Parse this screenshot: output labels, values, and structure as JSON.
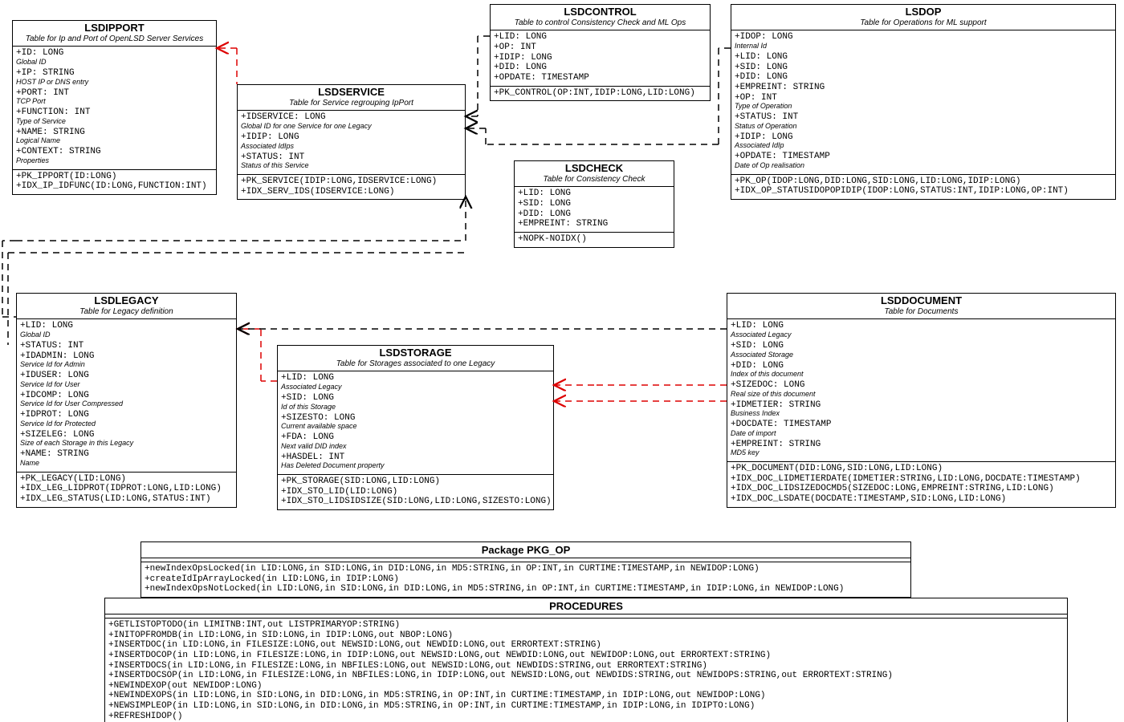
{
  "tables": {
    "lsdipport": {
      "name": "LSDIPPORT",
      "desc": "Table for Ip and Port of OpenLSD Server Services",
      "attrs": [
        {
          "sig": "+ID: LONG",
          "desc": "Global ID"
        },
        {
          "sig": "+IP: STRING",
          "desc": "HOST IP or DNS entry"
        },
        {
          "sig": "+PORT: INT",
          "desc": "TCP Port"
        },
        {
          "sig": "+FUNCTION: INT",
          "desc": "Type of Service"
        },
        {
          "sig": "+NAME: STRING",
          "desc": "Logical Name"
        },
        {
          "sig": "+CONTEXT: STRING",
          "desc": "Properties"
        }
      ],
      "ops": [
        "+PK_IPPORT(ID:LONG)",
        "+IDX_IP_IDFUNC(ID:LONG,FUNCTION:INT)"
      ]
    },
    "lsdservice": {
      "name": "LSDSERVICE",
      "desc": "Table for Service regrouping IpPort",
      "attrs": [
        {
          "sig": "+IDSERVICE: LONG",
          "desc": "Global ID for one Service for one Legacy"
        },
        {
          "sig": "+IDIP: LONG",
          "desc": "Associated IdIps"
        },
        {
          "sig": "+STATUS: INT",
          "desc": "Status of this Service"
        }
      ],
      "ops": [
        "+PK_SERVICE(IDIP:LONG,IDSERVICE:LONG)",
        "+IDX_SERV_IDS(IDSERVICE:LONG)"
      ]
    },
    "lsdcontrol": {
      "name": "LSDCONTROL",
      "desc": "Table to control Consistency Check and ML Ops",
      "attrs": [
        {
          "sig": "+LID: LONG"
        },
        {
          "sig": "+OP: INT"
        },
        {
          "sig": "+IDIP: LONG"
        },
        {
          "sig": "+DID: LONG"
        },
        {
          "sig": "+OPDATE: TIMESTAMP"
        }
      ],
      "ops": [
        "+PK_CONTROL(OP:INT,IDIP:LONG,LID:LONG)"
      ]
    },
    "lsdop": {
      "name": "LSDOP",
      "desc": "Table for Operations for ML support",
      "attrs": [
        {
          "sig": "+IDOP: LONG",
          "desc": "Internal Id"
        },
        {
          "sig": "+LID: LONG"
        },
        {
          "sig": "+SID: LONG"
        },
        {
          "sig": "+DID: LONG"
        },
        {
          "sig": "+EMPREINT: STRING"
        },
        {
          "sig": "+OP: INT",
          "desc": "Type of Operation"
        },
        {
          "sig": "+STATUS: INT",
          "desc": "Status of Operation"
        },
        {
          "sig": "+IDIP: LONG",
          "desc": "Associated IdIp"
        },
        {
          "sig": "+OPDATE: TIMESTAMP",
          "desc": "Date of Op realisation"
        }
      ],
      "ops": [
        "+PK_OP(IDOP:LONG,DID:LONG,SID:LONG,LID:LONG,IDIP:LONG)",
        "+IDX_OP_STATUSIDOPOPIDIP(IDOP:LONG,STATUS:INT,IDIP:LONG,OP:INT)"
      ]
    },
    "lsdcheck": {
      "name": "LSDCHECK",
      "desc": "Table for Consistency Check",
      "attrs": [
        {
          "sig": "+LID: LONG"
        },
        {
          "sig": "+SID: LONG"
        },
        {
          "sig": "+DID: LONG"
        },
        {
          "sig": "+EMPREINT: STRING"
        }
      ],
      "ops": [
        "+NOPK-NOIDX()"
      ]
    },
    "lsdlegacy": {
      "name": "LSDLEGACY",
      "desc": "Table for Legacy definition",
      "attrs": [
        {
          "sig": "+LID: LONG",
          "desc": "Global ID"
        },
        {
          "sig": "+STATUS: INT"
        },
        {
          "sig": "+IDADMIN: LONG",
          "desc": "Service Id for Admin"
        },
        {
          "sig": "+IDUSER: LONG",
          "desc": "Service Id for User"
        },
        {
          "sig": "+IDCOMP: LONG",
          "desc": "Service Id for User Compressed"
        },
        {
          "sig": "+IDPROT: LONG",
          "desc": "Service Id for Protected"
        },
        {
          "sig": "+SIZELEG: LONG",
          "desc": "Size of each Storage in this Legacy"
        },
        {
          "sig": "+NAME: STRING",
          "desc": "Name"
        }
      ],
      "ops": [
        "+PK_LEGACY(LID:LONG)",
        "+IDX_LEG_LIDPROT(IDPROT:LONG,LID:LONG)",
        "+IDX_LEG_STATUS(LID:LONG,STATUS:INT)"
      ]
    },
    "lsdstorage": {
      "name": "LSDSTORAGE",
      "desc": "Table for Storages associated to one Legacy",
      "attrs": [
        {
          "sig": "+LID: LONG",
          "desc": "Associated Legacy"
        },
        {
          "sig": "+SID: LONG",
          "desc": "Id of this Storage"
        },
        {
          "sig": "+SIZESTO: LONG",
          "desc": "Current available space"
        },
        {
          "sig": "+FDA: LONG",
          "desc": "Next valid DID index"
        },
        {
          "sig": "+HASDEL: INT",
          "desc": "Has Deleted Document property"
        }
      ],
      "ops": [
        "+PK_STORAGE(SID:LONG,LID:LONG)",
        "+IDX_STO_LID(LID:LONG)",
        "+IDX_STO_LIDSIDSIZE(SID:LONG,LID:LONG,SIZESTO:LONG)"
      ]
    },
    "lsddocument": {
      "name": "LSDDOCUMENT",
      "desc": "Table for Documents",
      "attrs": [
        {
          "sig": "+LID: LONG",
          "desc": "Associated Legacy"
        },
        {
          "sig": "+SID: LONG",
          "desc": "Associated Storage"
        },
        {
          "sig": "+DID: LONG",
          "desc": "Index of this document"
        },
        {
          "sig": "+SIZEDOC: LONG",
          "desc": "Real size of this document"
        },
        {
          "sig": "+IDMETIER: STRING",
          "desc": "Business Index"
        },
        {
          "sig": "+DOCDATE: TIMESTAMP",
          "desc": "Date of import"
        },
        {
          "sig": "+EMPREINT: STRING",
          "desc": "MD5 key"
        }
      ],
      "ops": [
        "+PK_DOCUMENT(DID:LONG,SID:LONG,LID:LONG)",
        "+IDX_DOC_LIDMETIERDATE(IDMETIER:STRING,LID:LONG,DOCDATE:TIMESTAMP)",
        "+IDX_DOC_LIDSIZEDOCMD5(SIZEDOC:LONG,EMPREINT:STRING,LID:LONG)",
        "+IDX_DOC_LSDATE(DOCDATE:TIMESTAMP,SID:LONG,LID:LONG)"
      ]
    }
  },
  "packages": {
    "pkg_op": {
      "name": "Package PKG_OP",
      "lines": [
        "+newIndexOpsLocked(in LID:LONG,in SID:LONG,in DID:LONG,in MD5:STRING,in OP:INT,in CURTIME:TIMESTAMP,in NEWIDOP:LONG)",
        "+createIdIpArrayLocked(in LID:LONG,in IDIP:LONG)",
        "+newIndexOpsNotLocked(in LID:LONG,in SID:LONG,in DID:LONG,in MD5:STRING,in OP:INT,in CURTIME:TIMESTAMP,in IDIP:LONG,in NEWIDOP:LONG)"
      ]
    },
    "procedures": {
      "name": "PROCEDURES",
      "lines": [
        "+GETLISTOPTODO(in LIMITNB:INT,out LISTPRIMARYOP:STRING)",
        "+INITOPFROMDB(in LID:LONG,in SID:LONG,in IDIP:LONG,out NBOP:LONG)",
        "+INSERTDOC(in LID:LONG,in FILESIZE:LONG,out NEWSID:LONG,out NEWDID:LONG,out ERRORTEXT:STRING)",
        "+INSERTDOCOP(in LID:LONG,in FILESIZE:LONG,in IDIP:LONG,out NEWSID:LONG,out NEWDID:LONG,out NEWIDOP:LONG,out ERRORTEXT:STRING)",
        "+INSERTDOCS(in LID:LONG,in FILESIZE:LONG,in NBFILES:LONG,out NEWSID:LONG,out NEWDIDS:STRING,out ERRORTEXT:STRING)",
        "+INSERTDOCSOP(in LID:LONG,in FILESIZE:LONG,in NBFILES:LONG,in IDIP:LONG,out NEWSID:LONG,out NEWDIDS:STRING,out NEWIDOPS:STRING,out ERRORTEXT:STRING)",
        "+NEWINDEXOP(out NEWIDOP:LONG)",
        "+NEWINDEXOPS(in LID:LONG,in SID:LONG,in DID:LONG,in MD5:STRING,in OP:INT,in CURTIME:TIMESTAMP,in IDIP:LONG,out NEWIDOP:LONG)",
        "+NEWSIMPLEOP(in LID:LONG,in SID:LONG,in DID:LONG,in MD5:STRING,in OP:INT,in CURTIME:TIMESTAMP,in IDIP:LONG,in IDIPTO:LONG)",
        "+REFRESHIDOP()"
      ]
    }
  }
}
